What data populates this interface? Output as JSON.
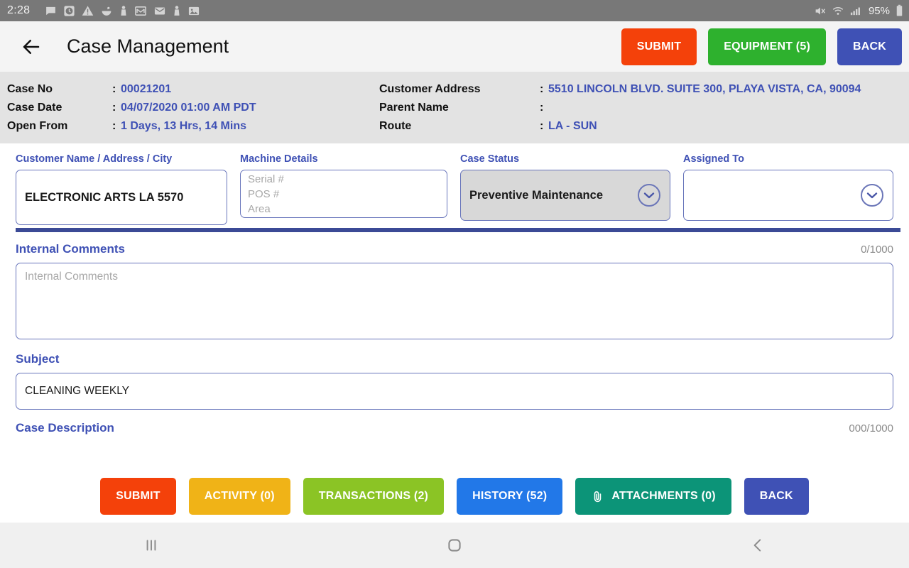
{
  "statusbar": {
    "time": "2:28",
    "battery": "95%",
    "left_icons": [
      "message-icon",
      "clock-icon",
      "warning-icon",
      "food-bowl-icon",
      "person-icon",
      "gmail-icon",
      "email-icon",
      "person-icon-2",
      "photo-icon"
    ],
    "right_icons": [
      "mute-icon",
      "wifi-icon",
      "signal-icon",
      "battery-icon"
    ]
  },
  "header": {
    "back_icon": "arrow-left-icon",
    "title": "Case Management",
    "buttons": [
      {
        "label": "SUBMIT",
        "color": "#f4410a",
        "name": "submit-button"
      },
      {
        "label": "EQUIPMENT (5)",
        "color": "#2eb12e",
        "name": "equipment-button"
      },
      {
        "label": "BACK",
        "color": "#3f51b5",
        "name": "back-button"
      }
    ]
  },
  "info": {
    "left": [
      {
        "label": "Case No",
        "value": "00021201"
      },
      {
        "label": "Case Date",
        "value": "04/07/2020 01:00 AM PDT"
      },
      {
        "label": "Open From",
        "value": "1 Days, 13 Hrs, 14 Mins"
      }
    ],
    "right": [
      {
        "label": "Customer Address",
        "value": "5510 LINCOLN BLVD. SUITE 300, PLAYA VISTA, CA, 90094"
      },
      {
        "label": "Parent Name",
        "value": ""
      },
      {
        "label": "Route",
        "value": "LA - SUN"
      }
    ]
  },
  "form": {
    "customer": {
      "label": "Customer Name / Address / City",
      "value": "ELECTRONIC ARTS LA 5570"
    },
    "machine": {
      "label": "Machine Details",
      "placeholders": [
        "Serial #",
        "POS #",
        "Area"
      ]
    },
    "case_status": {
      "label": "Case Status",
      "value": "Preventive Maintenance",
      "dropdown_icon": "chevron-down-circle-icon"
    },
    "assigned_to": {
      "label": "Assigned To",
      "value": "",
      "dropdown_icon": "chevron-down-circle-icon"
    }
  },
  "sections": {
    "internal_comments": {
      "label": "Internal Comments",
      "counter": "0/1000",
      "placeholder": "Internal Comments",
      "value": ""
    },
    "subject": {
      "label": "Subject",
      "value": "CLEANING WEEKLY"
    },
    "case_description": {
      "label": "Case Description",
      "counter": "000/1000"
    }
  },
  "bottom_buttons": [
    {
      "label": "SUBMIT",
      "color": "#f4410a",
      "name": "submit-button-bottom",
      "icon": ""
    },
    {
      "label": "ACTIVITY (0)",
      "color": "#f0b317",
      "name": "activity-button",
      "icon": ""
    },
    {
      "label": "TRANSACTIONS (2)",
      "color": "#8bc425",
      "name": "transactions-button",
      "icon": ""
    },
    {
      "label": "HISTORY (52)",
      "color": "#2278e8",
      "name": "history-button",
      "icon": ""
    },
    {
      "label": "ATTACHMENTS (0)",
      "color": "#0c9478",
      "name": "attachments-button",
      "icon": "paperclip-icon"
    },
    {
      "label": "BACK",
      "color": "#3f51b5",
      "name": "back-button-bottom",
      "icon": ""
    }
  ],
  "navbar": {
    "recents_icon": "recents-icon",
    "home_icon": "home-icon",
    "back_icon": "nav-back-icon"
  },
  "colors": {
    "accent_blue": "#3f51b5",
    "status_bar": "#787878",
    "info_strip": "#e3e3e3",
    "divider": "#3b4a96"
  }
}
